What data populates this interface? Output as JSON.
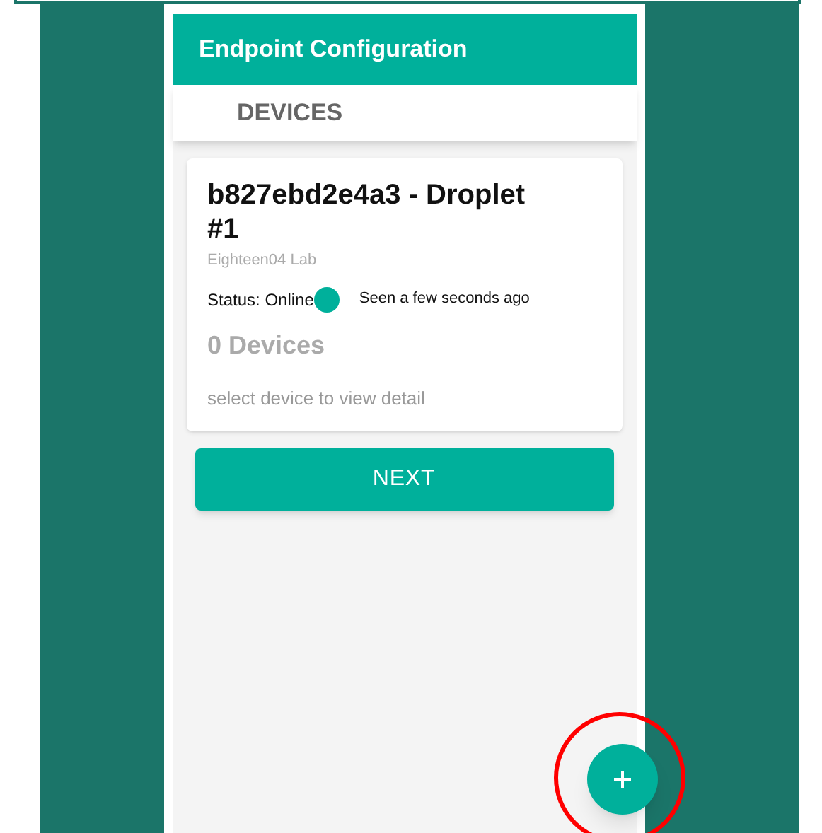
{
  "header": {
    "title": "Endpoint Configuration"
  },
  "tabs": [
    {
      "label": "DEVICES",
      "selected": true
    }
  ],
  "card": {
    "title": "b827ebd2e4a3 - Droplet #1",
    "subtitle": "Eighteen04 Lab",
    "status": "Status: Online",
    "online": true,
    "seen": "Seen a few seconds ago",
    "count": "0 Devices",
    "hint": "select device to view detail"
  },
  "next_button": "NEXT"
}
